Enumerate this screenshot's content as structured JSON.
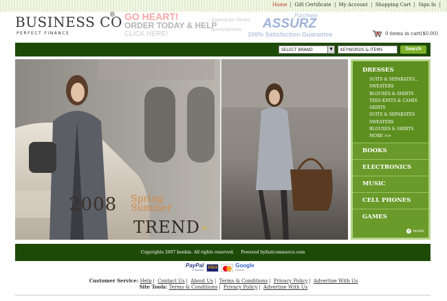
{
  "top_links": [
    {
      "label": "Home",
      "active": true
    },
    {
      "label": "Gift Certificate",
      "active": false
    },
    {
      "label": "My Account",
      "active": false
    },
    {
      "label": "Shopping Cart",
      "active": false
    },
    {
      "label": "Sign In",
      "active": false
    }
  ],
  "logo": {
    "name": "BUSINESS CO",
    "reg": "®",
    "tagline": "PERFECT FINANCE"
  },
  "promo": {
    "line1": "GO HEART!",
    "line2": "ORDER TODAY & HELP",
    "line3": "CLICK HERE!",
    "partner": "American Heart Associations"
  },
  "assurz": {
    "purchase": "Purchase",
    "brand": "ASSURZ",
    "guarantee": "100% Satisfaction Guarantee"
  },
  "cart": {
    "summary": "0 items in cart($0.00)",
    "icon": "shopping-cart-icon"
  },
  "search": {
    "brand_select": "SELECT BRAND",
    "keyword_value": "KEYWORDS & ITEMS",
    "button": "Search"
  },
  "hero": {
    "year": "2008",
    "spring": "Spring",
    "summer": "Summer",
    "trend": "TREND",
    "arrows": "»"
  },
  "sidebar": {
    "main_category": "DRESSES",
    "subitems": [
      "SUITS & SEPARATES...",
      "SWEATERS",
      "BLOUSES & SHIRTS",
      "TEES KNITS & CAMIS",
      "SKIRTS",
      "SUITS & SEPARATES",
      "SWEATERS",
      "BLOUSES & SHIRTS",
      "MORE >>"
    ],
    "categories": [
      "BOOKS",
      "ELECTRONICS",
      "MUSIC",
      "CELL PHONES",
      "GAMES"
    ],
    "more": "MORE"
  },
  "footer": {
    "copyright": "Copyrights 2007 benbin. All rights reserved.",
    "powered": "Powered byfastcommerce.com",
    "payment": {
      "paypal": "PayPal",
      "paypal_sub": "for Business",
      "visa": "VISA",
      "google": "Google",
      "google_sub": "Checkout"
    },
    "customer_service_label": "Customer Service:",
    "customer_service_links": [
      "Help",
      "Contact Us",
      "About Us",
      "Terms & Conditions",
      "Privacy Policy",
      "Advertise With Us"
    ],
    "site_tools_label": "Site Tools:",
    "site_tools_links": [
      "Terms & Conditions",
      "Privacy Policy",
      "Advertise With Us"
    ]
  },
  "colors": {
    "nav_green": "#1e4a08",
    "sidebar_green": "#6a9a2a",
    "search_button": "#7cb02a",
    "accent_orange": "#d28a46"
  }
}
